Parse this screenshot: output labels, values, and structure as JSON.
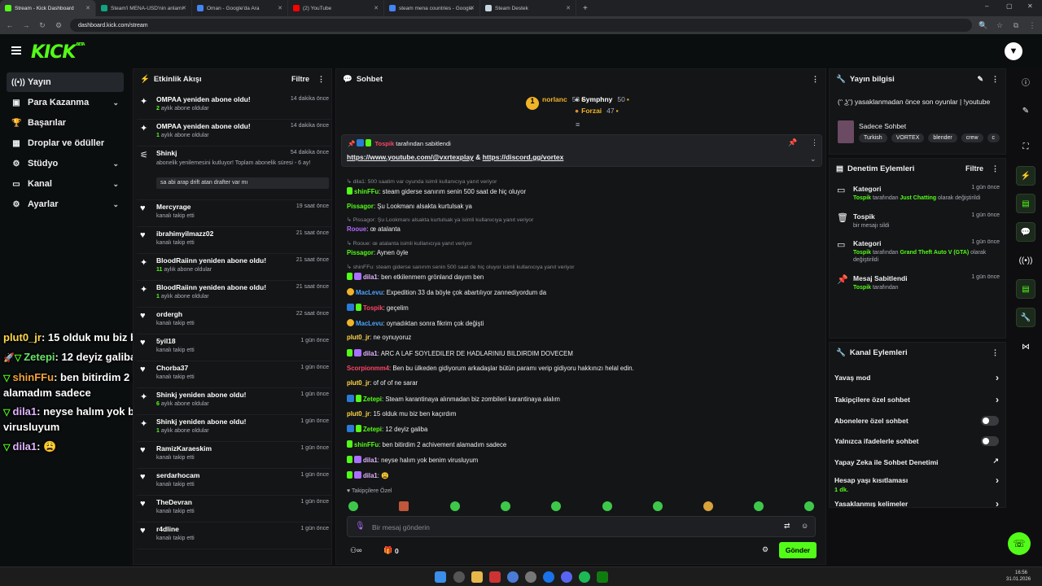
{
  "browser": {
    "tabs": [
      {
        "title": "Stream - Kick Dashboard",
        "color": "#53fc18"
      },
      {
        "title": "Steam'i MENA-USD'nin anlamı",
        "color": "#10a37f"
      },
      {
        "title": "Oman - Google'da Ara",
        "color": "#4285f4"
      },
      {
        "title": "(2) YouTube",
        "color": "#ff0000"
      },
      {
        "title": "steam mena countries - Google",
        "color": "#4285f4"
      },
      {
        "title": "Steam Destek",
        "color": "#c7d5e0"
      }
    ],
    "url": "dashboard.kick.com/stream",
    "new_tab": "+"
  },
  "header": {
    "logo": "KICK",
    "logo_badge": "BETA"
  },
  "nav": {
    "items": [
      {
        "label": "Yayın",
        "icon": "radio-icon"
      },
      {
        "label": "Para Kazanma",
        "icon": "wallet-icon"
      },
      {
        "label": "Başarılar",
        "icon": "trophy-icon"
      },
      {
        "label": "Droplar ve ödüller",
        "icon": "gift-icon"
      },
      {
        "label": "Stüdyo",
        "icon": "gear-icon"
      },
      {
        "label": "Kanal",
        "icon": "chat-icon"
      },
      {
        "label": "Ayarlar",
        "icon": "settings-icon"
      }
    ]
  },
  "overlay": [
    {
      "user": "plut0_jr",
      "text": "15 olduk mu biz ben kaçırdım",
      "color": "#ffd84a"
    },
    {
      "user": "Zetepi",
      "text": "12 deyiz galiba",
      "color": "#6be26b"
    },
    {
      "user": "shinFFu",
      "text": "ben bitirdim 2 achivement alamadım sadece",
      "color": "#f2a33a"
    },
    {
      "user": "dila1",
      "text": "neyse halım yok benim virusluyum",
      "color": "#e0b4ff"
    },
    {
      "user": "dila1",
      "text": "😩",
      "color": "#e0b4ff"
    }
  ],
  "activity": {
    "title": "Etkinlik Akışı",
    "filter": "Filtre",
    "items": [
      {
        "title": "OMPAA yeniden abone oldu!",
        "sub_bold": "2",
        "sub": " aylık abone oldular",
        "time": "14 dakika önce",
        "icon": "sparkle-icon"
      },
      {
        "title": "OMPAA yeniden abone oldu!",
        "sub_bold": "1",
        "sub": " aylık abone oldular",
        "time": "14 dakika önce",
        "icon": "sparkle-icon"
      },
      {
        "title": "Shinkj",
        "sub_bold": "",
        "sub": "abonelik yenilemesini kutluyor! Toplam abonelik süresi - 6 ay!",
        "time": "54 dakika önce",
        "icon": "party-icon",
        "msg": "sa abi arap drift atan drafter var mı"
      },
      {
        "title": "Mercyrage",
        "sub_bold": "",
        "sub": "kanalı takip etti",
        "time": "19 saat önce",
        "icon": "heart-icon"
      },
      {
        "title": "ibrahimyilmazz02",
        "sub_bold": "",
        "sub": "kanalı takip etti",
        "time": "21 saat önce",
        "icon": "heart-icon"
      },
      {
        "title": "BloodRaiinn yeniden abone oldu!",
        "sub_bold": "11",
        "sub": " aylık abone oldular",
        "time": "21 saat önce",
        "icon": "sparkle-icon"
      },
      {
        "title": "BloodRaiinn yeniden abone oldu!",
        "sub_bold": "1",
        "sub": " aylık abone oldular",
        "time": "21 saat önce",
        "icon": "sparkle-icon"
      },
      {
        "title": "ordergh",
        "sub_bold": "",
        "sub": "kanalı takip etti",
        "time": "22 saat önce",
        "icon": "heart-icon"
      },
      {
        "title": "5yil18",
        "sub_bold": "",
        "sub": "kanalı takip etti",
        "time": "1 gün önce",
        "icon": "heart-icon"
      },
      {
        "title": "Chorba37",
        "sub_bold": "",
        "sub": "kanalı takip etti",
        "time": "1 gün önce",
        "icon": "heart-icon"
      },
      {
        "title": "Shinkj yeniden abone oldu!",
        "sub_bold": "6",
        "sub": " aylık abone oldular",
        "time": "1 gün önce",
        "icon": "sparkle-icon"
      },
      {
        "title": "Shinkj yeniden abone oldu!",
        "sub_bold": "1",
        "sub": " aylık abone oldular",
        "time": "1 gün önce",
        "icon": "sparkle-icon"
      },
      {
        "title": "RamizKaraeskim",
        "sub_bold": "",
        "sub": "kanalı takip etti",
        "time": "1 gün önce",
        "icon": "heart-icon"
      },
      {
        "title": "serdarhocam",
        "sub_bold": "",
        "sub": "kanalı takip etti",
        "time": "1 gün önce",
        "icon": "heart-icon"
      },
      {
        "title": "TheDevran",
        "sub_bold": "",
        "sub": "kanalı takip etti",
        "time": "1 gün önce",
        "icon": "heart-icon"
      },
      {
        "title": "r4dline",
        "sub_bold": "",
        "sub": "kanalı takip etti",
        "time": "1 gün önce",
        "icon": "heart-icon"
      }
    ]
  },
  "chat": {
    "title": "Sohbet",
    "leaderboard": [
      {
        "name": "norlanc",
        "value": "53"
      },
      {
        "name": "Symphny",
        "value": "50"
      },
      {
        "name": "Forzai",
        "value": "47"
      }
    ],
    "pinned": {
      "by": "Tospik",
      "label": "tarafından sabitlendi",
      "link1": "https://www.youtube.com/@vxrtexplay",
      "amp": "&",
      "link2": "https://discord.gg/vortex"
    },
    "messages": [
      {
        "type": "reply",
        "text": "↳ dila1: 500 saatim var oyunda isimli kullanıcıya yanıt veriyor"
      },
      {
        "user": "shinFFu",
        "color": "#53fc18",
        "text": "steam giderse sanırım senin 500 saat de hiç oluyor"
      },
      {
        "user": "Pissagor",
        "color": "#53fc18",
        "text": "Şu Lookmanı alsakta kurtulsak ya"
      },
      {
        "type": "reply",
        "text": "↳ Pissagor: Şu Lookmanı alsakta kurtulsak ya isimli kullanıcıya yanıt veriyor"
      },
      {
        "user": "Rooue",
        "color": "#b36bff",
        "text": "œ atalanta"
      },
      {
        "type": "reply",
        "text": "↳ Rooue: œ atalanta isimli kullanıcıya yanıt veriyor"
      },
      {
        "user": "Pissagor",
        "color": "#53fc18",
        "text": "Aynen öyle"
      },
      {
        "type": "reply",
        "text": "↳ shinFFu: steam giderse sanırım senin 500 saat de hiç oluyor isimli kullanıcıya yanıt veriyor"
      },
      {
        "user": "dila1",
        "color": "#e0b4ff",
        "text": "ben etkilenmem grönland dayım ben"
      },
      {
        "user": "MacLevu",
        "color": "#4aa3ff",
        "text": "Expedition 33 da böyle çok abartılıyor zannediyordum da"
      },
      {
        "user": "Tospik",
        "color": "#ff4466",
        "text": "geçelim"
      },
      {
        "user": "MacLevu",
        "color": "#4aa3ff",
        "text": "oynadıktan sonra fikrim çok değişti"
      },
      {
        "user": "plut0_jr",
        "color": "#ffd84a",
        "text": "ne oynuyoruz"
      },
      {
        "user": "dila1",
        "color": "#e0b4ff",
        "text": "ARC A LAF SOYLEDILER DE HADLARINIU BILDIRDIM DOVECEM"
      },
      {
        "user": "Scorpionmm4",
        "color": "#ff4466",
        "text": "Ben bu ülkeden gidiyorum arkadaşlar bütün paramı verip gidiyoru hakkınızı helal edin."
      },
      {
        "user": "plut0_jr",
        "color": "#ffd84a",
        "text": "of of of ne sarar"
      },
      {
        "user": "Zetepi",
        "color": "#53fc18",
        "text": "Steam karantinaya alınmadan biz zombileri karantinaya alalım"
      },
      {
        "user": "plut0_jr",
        "color": "#ffd84a",
        "text": "15 olduk mu biz ben kaçırdım"
      },
      {
        "user": "Zetepi",
        "color": "#53fc18",
        "text": "12 deyiz galiba"
      },
      {
        "user": "shinFFu",
        "color": "#53fc18",
        "text": "ben bitirdim 2 achivement alamadım sadece"
      },
      {
        "user": "dila1",
        "color": "#e0b4ff",
        "text": "neyse halım yok benim virusluyum"
      },
      {
        "user": "dila1",
        "color": "#e0b4ff",
        "text": "😩"
      }
    ],
    "followers_only": "Takipçilere Özel",
    "input_placeholder": "Bir mesaj gönderin",
    "viewer_count": "0",
    "send": "Gönder"
  },
  "stream_info": {
    "title": "Yayın bilgisi",
    "stream_title": "(ᵔ ͜ʖᵔ) yasaklanmadan önce son oyunlar | !youtube",
    "category": "Sadece Sohbet",
    "tags": [
      "Turkish",
      "VORTEX",
      "blender",
      "crew",
      "c"
    ]
  },
  "mod_actions": {
    "title": "Denetim Eylemleri",
    "filter": "Filtre",
    "items": [
      {
        "title": "Kategori",
        "time": "1 gün önce",
        "icon": "category-icon",
        "user": "Tospik",
        "pre": " tarafından ",
        "hl": "Just Chatting",
        "post": " olarak değiştirildi"
      },
      {
        "title": "Tospik",
        "time": "1 gün önce",
        "icon": "trash-icon",
        "user": "",
        "pre": "bir mesajı sildi",
        "hl": "",
        "post": ""
      },
      {
        "title": "Kategori",
        "time": "1 gün önce",
        "icon": "category-icon",
        "user": "Tospik",
        "pre": " tarafından ",
        "hl": "Grand Theft Auto V (GTA)",
        "post": " olarak değiştirildi"
      },
      {
        "title": "Mesaj Sabitlendi",
        "time": "1 gün önce",
        "icon": "pin-icon",
        "user": "Tospik",
        "pre": " tarafından",
        "hl": "",
        "post": ""
      }
    ]
  },
  "channel_actions": {
    "title": "Kanal Eylemleri",
    "items": [
      {
        "label": "Yavaş mod",
        "kind": "arrow",
        "sub": ""
      },
      {
        "label": "Takipçilere özel sohbet",
        "kind": "arrow",
        "sub": ""
      },
      {
        "label": "Abonelere özel sohbet",
        "kind": "toggle",
        "sub": ""
      },
      {
        "label": "Yalnızca ifadelerle sohbet",
        "kind": "toggle",
        "sub": ""
      },
      {
        "label": "Yapay Zeka ile Sohbet Denetimi",
        "kind": "external",
        "sub": ""
      },
      {
        "label": "Hesap yaşı kısıtlaması",
        "kind": "arrow",
        "sub": "1 dk."
      },
      {
        "label": "Yasaklanmış kelimeler",
        "kind": "arrow",
        "sub": ""
      }
    ]
  },
  "taskbar": {
    "time": "16:56",
    "date": "31.01.2026"
  }
}
